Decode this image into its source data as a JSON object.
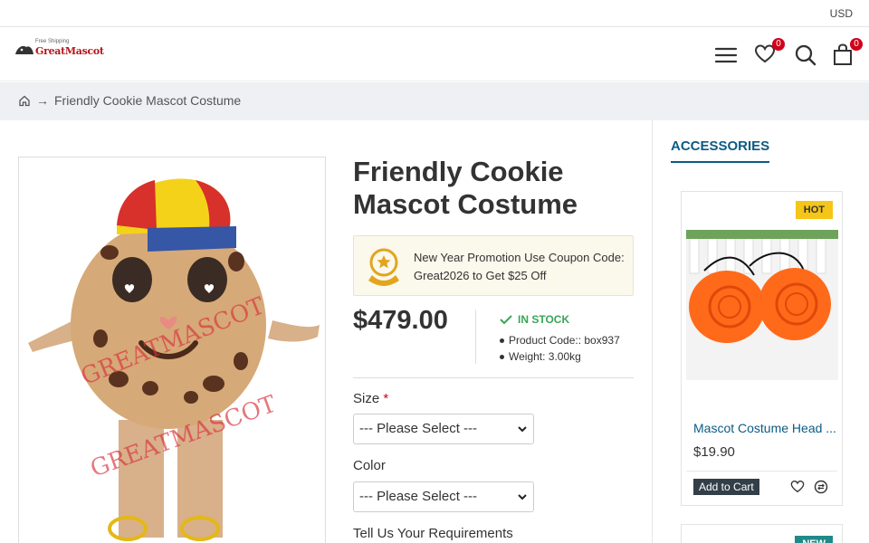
{
  "topbar": {
    "currency": "USD"
  },
  "header": {
    "logo_tagline": "Free Shipping",
    "logo_name": "GreatMascot",
    "wishlist_count": "0",
    "cart_count": "0",
    "icons": [
      "menu-icon",
      "heart-icon",
      "search-icon",
      "cart-icon"
    ]
  },
  "breadcrumb": {
    "arrow": "→",
    "current": "Friendly Cookie Mascot Costume"
  },
  "product": {
    "title": "Friendly Cookie Mascot Costume",
    "image_watermark": "GREATMASCOT",
    "promo": "New Year Promotion Use Coupon Code: Great2026 to Get $25 Off",
    "price": "$479.00",
    "stock": "IN STOCK",
    "product_code": "Product Code:: box937",
    "weight": "Weight: 3.00kg",
    "size_label": "Size",
    "required_mark": "*",
    "size_placeholder": "--- Please Select ---",
    "color_label": "Color",
    "color_placeholder": "--- Please Select ---",
    "requirements_label": "Tell Us Your Requirements"
  },
  "sidebar": {
    "title": "ACCESSORIES",
    "card1": {
      "badge": "HOT",
      "name": "Mascot Costume Head ...",
      "price": "$19.90",
      "add_to_cart": "Add to Cart"
    },
    "card2": {
      "badge": "NEW"
    }
  },
  "colors": {
    "accent_blue": "#0b5b84",
    "price_red_badge": "#d0021b",
    "stock_green": "#3aa657",
    "hot_badge": "#f5c518",
    "new_badge": "#1f8a87"
  }
}
